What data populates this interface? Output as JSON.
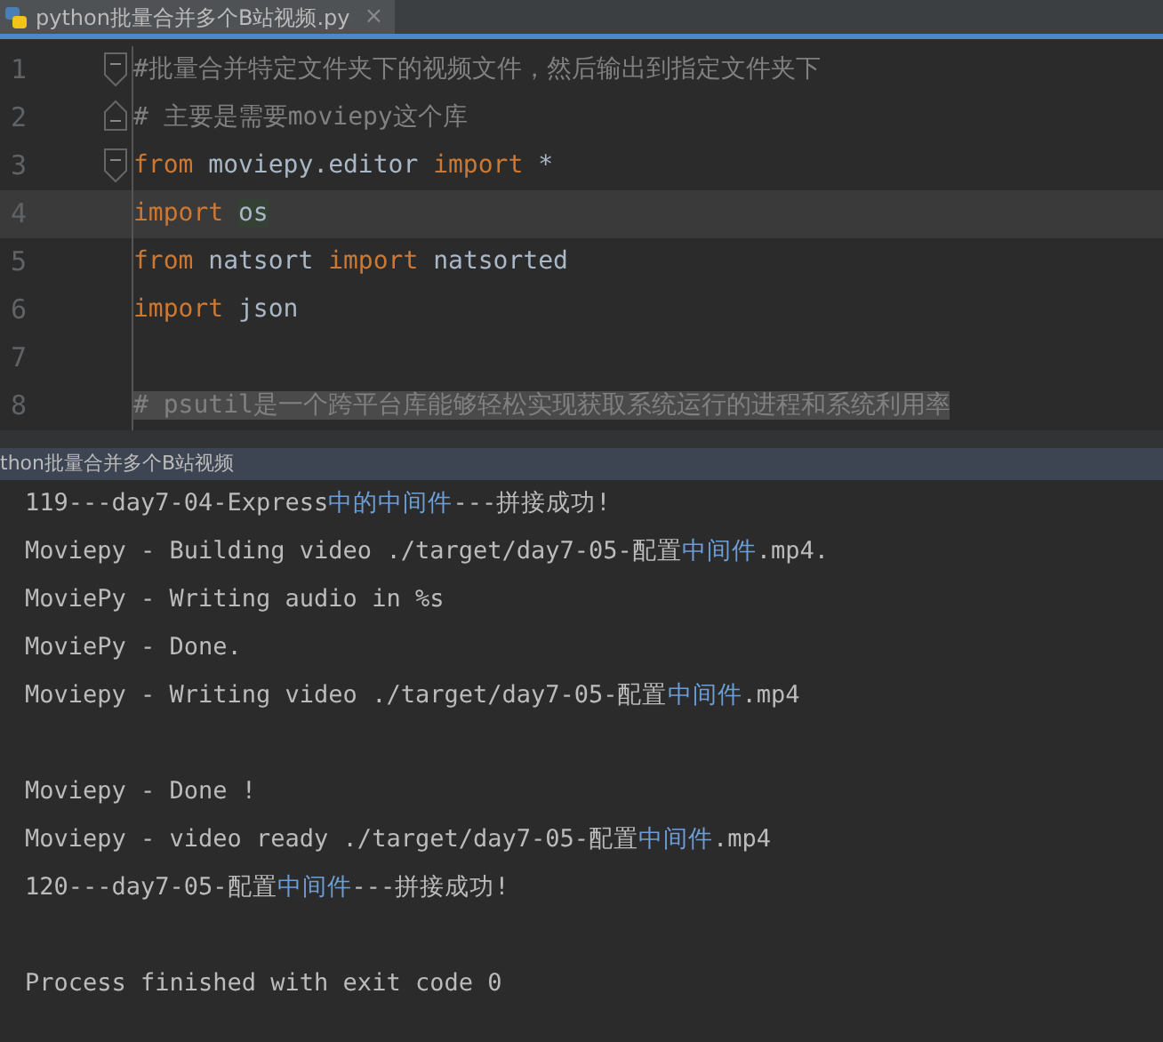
{
  "editor_tab": {
    "title": "python批量合并多个B站视频.py",
    "close": "×",
    "selected": true
  },
  "code_lines": [
    {
      "number": "1",
      "fold_start": true,
      "fold_end": false,
      "current": false,
      "tokens": [
        {
          "kind": "comment",
          "text": "#批量合并特定文件夹下的视频文件，然后输出到指定文件夹下"
        }
      ]
    },
    {
      "number": "2",
      "fold_start": false,
      "fold_end": true,
      "current": false,
      "tokens": [
        {
          "kind": "comment",
          "text": "# 主要是需要moviepy这个库"
        }
      ]
    },
    {
      "number": "3",
      "fold_start": true,
      "fold_end": false,
      "current": false,
      "tokens": [
        {
          "kind": "keyword",
          "text": "from"
        },
        {
          "kind": "name",
          "text": " moviepy.editor "
        },
        {
          "kind": "keyword",
          "text": "import"
        },
        {
          "kind": "name",
          "text": " *"
        }
      ]
    },
    {
      "number": "4",
      "fold_start": false,
      "fold_end": false,
      "current": true,
      "tokens": [
        {
          "kind": "keyword",
          "text": "import"
        },
        {
          "kind": "usage",
          "text": "os"
        }
      ]
    },
    {
      "number": "5",
      "fold_start": false,
      "fold_end": false,
      "current": false,
      "tokens": [
        {
          "kind": "keyword",
          "text": "from"
        },
        {
          "kind": "name",
          "text": " natsort "
        },
        {
          "kind": "keyword",
          "text": "import"
        },
        {
          "kind": "name",
          "text": " natsorted"
        }
      ]
    },
    {
      "number": "6",
      "fold_start": false,
      "fold_end": false,
      "current": false,
      "tokens": [
        {
          "kind": "keyword",
          "text": "import"
        },
        {
          "kind": "name",
          "text": " json"
        }
      ]
    },
    {
      "number": "7",
      "fold_start": false,
      "fold_end": false,
      "current": false
    },
    {
      "number": "8",
      "fold_start": false,
      "fold_end": false,
      "current": false,
      "tokens": [
        {
          "kind": "marked",
          "text": "# psutil是一个跨平台库能够轻松实现获取系统运行的进程和系统利用率"
        }
      ]
    }
  ],
  "run_panel": {
    "title": "thon批量合并多个B站视频"
  },
  "output_lines": [
    {
      "kind": "text",
      "segments": [
        {
          "text": "119---day7-04-Express",
          "accent": false
        },
        {
          "text": "中的中间件",
          "accent": true
        },
        {
          "text": "---拼接成功!",
          "accent": false
        }
      ]
    },
    {
      "kind": "text",
      "segments": [
        {
          "text": "Moviepy - Building video ./target/day7-05-配置",
          "accent": false
        },
        {
          "text": "中间件",
          "accent": true
        },
        {
          "text": ".mp4.",
          "accent": false
        }
      ]
    },
    {
      "kind": "text",
      "segments": [
        {
          "text": "MoviePy - Writing audio in %s",
          "accent": false
        }
      ]
    },
    {
      "kind": "text",
      "segments": [
        {
          "text": "MoviePy - Done.",
          "accent": false
        }
      ]
    },
    {
      "kind": "text",
      "segments": [
        {
          "text": "Moviepy - Writing video ./target/day7-05-配置",
          "accent": false
        },
        {
          "text": "中间件",
          "accent": true
        },
        {
          "text": ".mp4",
          "accent": false
        }
      ]
    },
    {
      "kind": "blank"
    },
    {
      "kind": "text",
      "segments": [
        {
          "text": "Moviepy - Done !",
          "accent": false
        }
      ]
    },
    {
      "kind": "text",
      "segments": [
        {
          "text": "Moviepy - video ready ./target/day7-05-配置",
          "accent": false
        },
        {
          "text": "中间件",
          "accent": true
        },
        {
          "text": ".mp4",
          "accent": false
        }
      ]
    },
    {
      "kind": "text",
      "segments": [
        {
          "text": "120---day7-05-配置",
          "accent": false
        },
        {
          "text": "中间件",
          "accent": true
        },
        {
          "text": "---拼接成功!",
          "accent": false
        }
      ]
    },
    {
      "kind": "blank"
    },
    {
      "kind": "text",
      "segments": [
        {
          "text": "Process finished with exit code 0",
          "accent": false
        }
      ]
    }
  ]
}
